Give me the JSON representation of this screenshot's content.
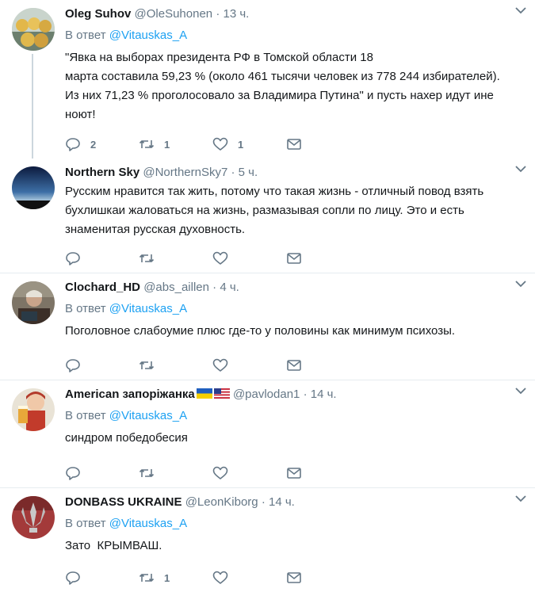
{
  "tweets": [
    {
      "name": "Oleg Suhov",
      "handle": "@OleSuhonen",
      "time": "13 ч.",
      "reply_prefix": "В ответ",
      "reply_user": "@Vitauskas_A",
      "text": "\"Явка на выборах президента РФ в Томской области 18\nмарта составила 59,23 % (около 461 тысячи человек из 778 244 избирателей).\nИз них 71,23 % проголосовало за Владимира Путина\" и пусть нахер идут ине\nноют!",
      "replies": "2",
      "retweets": "1",
      "likes": "1"
    },
    {
      "name": "Northern Sky",
      "handle": "@NorthernSky7",
      "time": "5 ч.",
      "text": "Русским нравится так жить, потому что такая жизнь - отличный повод взять\nбухлишкаи жаловаться на жизнь, размазывая сопли по лицу. Это и есть\nзнаменитая русская духовность.",
      "replies": "",
      "retweets": "",
      "likes": ""
    },
    {
      "name": "Clochard_HD",
      "handle": "@abs_aillen",
      "time": "4 ч.",
      "reply_prefix": "В ответ",
      "reply_user": "@Vitauskas_A",
      "text": "Поголовное слабоумие плюс где-то у половины как минимум психозы.",
      "replies": "",
      "retweets": "",
      "likes": ""
    },
    {
      "name": "American запоріжанка",
      "handle": "@pavlodan1",
      "time": "14 ч.",
      "reply_prefix": "В ответ",
      "reply_user": "@Vitauskas_A",
      "text": "синдром победобесия",
      "replies": "",
      "retweets": "",
      "likes": ""
    },
    {
      "name": "DONBASS UKRAINE",
      "handle": "@LeonKiborg",
      "time": "14 ч.",
      "reply_prefix": "В ответ",
      "reply_user": "@Vitauskas_A",
      "text": "Зато  КРЫМВАШ.",
      "replies": "",
      "retweets": "1",
      "likes": ""
    }
  ],
  "dot": "·",
  "icons": {
    "reply": "reply-icon",
    "retweet": "retweet-icon",
    "like": "heart-icon",
    "dm": "envelope-icon",
    "more": "chevron-down-icon"
  },
  "colors": {
    "link": "#1da1f2",
    "muted": "#657786",
    "border": "#e6ecf0"
  }
}
